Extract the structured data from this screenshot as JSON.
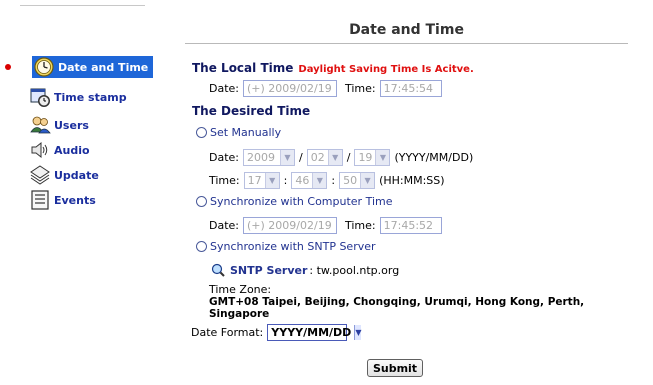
{
  "page": {
    "title": "Date and Time"
  },
  "sidebar": {
    "items": [
      {
        "label": "Date and Time",
        "icon": "clock-icon",
        "active": true
      },
      {
        "label": "Time stamp",
        "icon": "calendar-clock-icon"
      },
      {
        "label": "Users",
        "icon": "users-icon"
      },
      {
        "label": "Audio",
        "icon": "speaker-icon"
      },
      {
        "label": "Update",
        "icon": "update-icon"
      },
      {
        "label": "Events",
        "icon": "document-icon"
      }
    ]
  },
  "local_time": {
    "heading": "The Local Time",
    "dst_notice": "Daylight Saving Time Is Acitve.",
    "date_label": "Date:",
    "date_value": "(+) 2009/02/19",
    "time_label": "Time:",
    "time_value": "17:45:54"
  },
  "desired_time": {
    "heading": "The Desired Time",
    "manual": {
      "label": "Set Manually",
      "date_label": "Date:",
      "year": "2009",
      "month": "02",
      "day": "19",
      "sep": "/",
      "date_format_hint": "(YYYY/MM/DD)",
      "time_label": "Time:",
      "hour": "17",
      "minute": "46",
      "second": "50",
      "time_sep": ":",
      "time_format_hint": "(HH:MM:SS)"
    },
    "computer": {
      "label": "Synchronize with Computer Time",
      "date_label": "Date:",
      "date_value": "(+) 2009/02/19",
      "time_label": "Time:",
      "time_value": "17:45:52"
    },
    "sntp": {
      "label": "Synchronize with SNTP Server",
      "server_label": "SNTP Server",
      "server_value": ": tw.pool.ntp.org",
      "timezone_label": "Time Zone:",
      "timezone_line1": "GMT+08 Taipei, Beijing, Chongqing, Urumqi, Hong Kong, Perth,",
      "timezone_line2": "Singapore"
    }
  },
  "date_format": {
    "label": "Date Format:",
    "value": "YYYY/MM/DD"
  },
  "submit": {
    "label": "Submit"
  },
  "colors": {
    "accent": "#1e66d8",
    "heading": "#101860",
    "warning": "#e01010",
    "link": "#223390"
  }
}
